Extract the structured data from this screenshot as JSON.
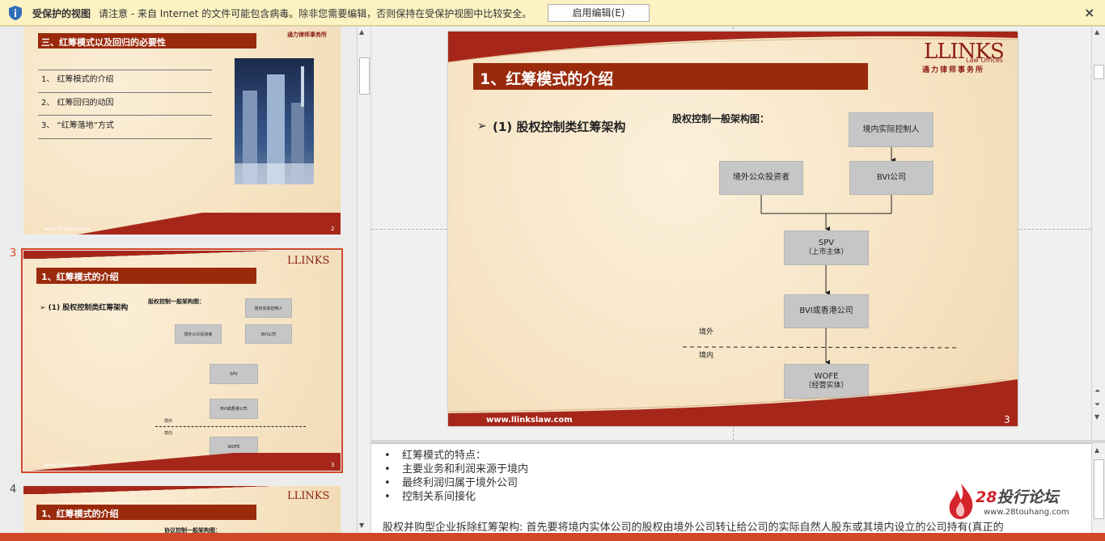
{
  "protected_view": {
    "title": "受保护的视图",
    "message": "请注意 - 来自 Internet 的文件可能包含病毒。除非您需要编辑，否则保持在受保护视图中比较安全。",
    "enable_button": "启用编辑(E)",
    "close_glyph": "×"
  },
  "thumbnails": {
    "slide2": {
      "header": "三、红筹模式以及回归的必要性",
      "items": [
        "1、 红筹模式的介绍",
        "2、 红筹回归的动因",
        "3、 “红筹落地”方式"
      ],
      "footer_url": "www.llinkslaw.com",
      "page": "2"
    },
    "slide3": {
      "number": "3",
      "title": "1、红筹模式的介绍",
      "subtitle": "➢ (1) 股权控制类红筹架构",
      "diagram_title": "股权控制一般架构图：",
      "footer_url": "www.llinkslaw.com",
      "page": "3"
    },
    "slide4": {
      "number": "4",
      "title": "1、红筹模式的介绍",
      "diagram_title": "协议控制一般架构图："
    }
  },
  "slide": {
    "title": "1、红筹模式的介绍",
    "subtitle_arrow": "➢",
    "subtitle": "(1) 股权控制类红筹架构",
    "diagram_title": "股权控制一般架构图：",
    "logo_main": "LLINKS",
    "logo_sub": "Law Offices",
    "logo_cn": "通力律师事务所",
    "boxes": {
      "domestic_controller": "境内实际控制人",
      "foreign_investors": "境外公众投资者",
      "bvi": "BVI公司",
      "spv": "SPV",
      "spv_sub": "（上市主体）",
      "bvi_hk": "BVI或香港公司",
      "wofe": "WOFE",
      "wofe_sub": "（经营实体）"
    },
    "abroad_label": "境外",
    "domestic_label": "境内",
    "footer_url": "www.llinkslaw.com",
    "page_number": "3"
  },
  "notes": {
    "bullets": [
      "红筹模式的特点：",
      "主要业务和利润来源于境内",
      "最终利润归属于境外公司",
      "控制关系间接化"
    ],
    "paragraph": "股权并购型企业拆除红筹架构: 首先要将境内实体公司的股权由境外公司转让给公司的实际自然人股东或其境内设立的公司持有(真正的"
  },
  "watermark": {
    "num": "28",
    "text": "投行论坛",
    "url": "www.28touhang.com"
  },
  "colors": {
    "accent": "#d24726",
    "slide_title_bg": "#9a2a0c",
    "slide_bg": "#f7e7ca"
  }
}
